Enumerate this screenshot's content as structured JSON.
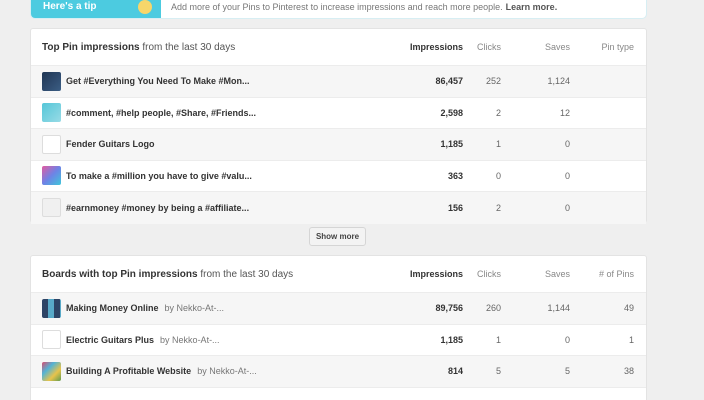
{
  "tip": {
    "title": "Here's a tip",
    "text": "Add more of your Pins to Pinterest to increase impressions and reach more people.",
    "link": "Learn more."
  },
  "top_pins": {
    "title": "Top Pin impressions",
    "subtitle": "from the last 30 days",
    "columns": [
      "Impressions",
      "Clicks",
      "Saves",
      "Pin type"
    ],
    "rows": [
      {
        "name": "Get #Everything You Need To Make #Mon...",
        "impressions": "86,457",
        "clicks": "252",
        "saves": "1,124",
        "thumb": "dark"
      },
      {
        "name": "#comment, #help people, #Share, #Friends...",
        "impressions": "2,598",
        "clicks": "2",
        "saves": "12",
        "thumb": "teal"
      },
      {
        "name": "Fender Guitars Logo",
        "impressions": "1,185",
        "clicks": "1",
        "saves": "0",
        "thumb": "guitar"
      },
      {
        "name": "To make a #million you have to give #valu...",
        "impressions": "363",
        "clicks": "0",
        "saves": "0",
        "thumb": "color"
      },
      {
        "name": "#earnmoney #money by being a #affiliate...",
        "impressions": "156",
        "clicks": "2",
        "saves": "0",
        "thumb": "doc"
      }
    ],
    "show_more": "Show more"
  },
  "boards": {
    "title": "Boards with top Pin impressions",
    "subtitle": "from the last 30 days",
    "columns": [
      "Impressions",
      "Clicks",
      "Saves",
      "# of Pins"
    ],
    "rows": [
      {
        "name": "Making Money Online",
        "owner": "by Nekko-At-...",
        "impressions": "89,756",
        "clicks": "260",
        "saves": "1,144",
        "pins": "49"
      },
      {
        "name": "Electric Guitars Plus",
        "owner": "by Nekko-At-...",
        "impressions": "1,185",
        "clicks": "1",
        "saves": "0",
        "pins": "1"
      },
      {
        "name": "Building A Profitable Website",
        "owner": "by Nekko-At-...",
        "impressions": "814",
        "clicks": "5",
        "saves": "5",
        "pins": "38"
      }
    ]
  }
}
